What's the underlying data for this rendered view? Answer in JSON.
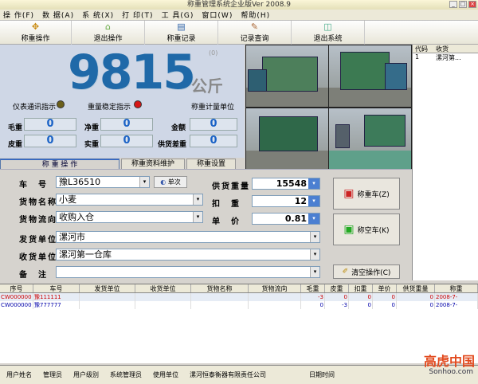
{
  "window": {
    "title": "称重管理系统企业版Ver 2008.9"
  },
  "menu": [
    "操 作(F)",
    "数 据(A)",
    "系 统(X)",
    "打 印(T)",
    "工 具(G)",
    "窗口(W)",
    "帮助(H)"
  ],
  "toolbar": [
    {
      "label": "称重操作",
      "icon": "✥"
    },
    {
      "label": "退出操作",
      "icon": "⌂"
    },
    {
      "label": "称重记录",
      "icon": "▤"
    },
    {
      "label": "记录查询",
      "icon": "✎"
    },
    {
      "label": "退出系统",
      "icon": "◫"
    }
  ],
  "display": {
    "weight": "9815",
    "unit": "公斤",
    "small_value": "(0)",
    "ind_comm": "仪表通讯指示",
    "ind_stable": "重量稳定指示",
    "ind_unit": "称重计量单位",
    "comm_color": "#6b5f1a",
    "stable_color": "#d61616"
  },
  "summary": {
    "gross_label": "毛重",
    "gross": "0",
    "net_label": "净重",
    "net": "0",
    "amount_label": "金额",
    "amount": "0",
    "tare_label": "皮重",
    "tare": "0",
    "actual_label": "实重",
    "actual": "0",
    "diff_label": "供货差重",
    "diff": "0"
  },
  "tabs": [
    "称 重 操 作",
    "称重资料维护",
    "称重设置"
  ],
  "form": {
    "plate_label": "车　号",
    "plate": "豫L36510",
    "single_label": "单次",
    "goods_label": "货物名称",
    "goods": "小麦",
    "flow_label": "货物流向",
    "flow": "收购入仓",
    "sender_label": "发货单位",
    "sender": "漯河市",
    "receiver_label": "收货单位",
    "receiver": "漯河第一仓库",
    "note_label": "备　注",
    "note": "",
    "supply_label": "供货重量",
    "supply": "15548",
    "deduct_label": "扣　重",
    "deduct": "12",
    "price_label": "单　价",
    "price": "0.81"
  },
  "actions": {
    "heavy": "称重车(Z)",
    "empty": "称空车(K)",
    "clear": "清空操作(C)"
  },
  "right_panel": {
    "headers": [
      "代码",
      "收货"
    ],
    "rows": [
      [
        "1",
        "漯河第..."
      ]
    ]
  },
  "grid": {
    "headers": [
      "序号",
      "车号",
      "发货单位",
      "收货单位",
      "货物名称",
      "货物流向",
      "毛重",
      "皮重",
      "扣重",
      "单价",
      "供货重量",
      "称重"
    ],
    "rows": [
      [
        "CW000000",
        "豫111111",
        "",
        "",
        "",
        "",
        "-3",
        "0",
        "0",
        "0",
        "0",
        "2008-7-"
      ],
      [
        "CW000000",
        "豫777777",
        "",
        "",
        "",
        "",
        "0",
        "-3",
        "0",
        "0",
        "0",
        "2008-7-"
      ]
    ]
  },
  "status": [
    "用户姓名",
    "管理员",
    "用户级别",
    "系统管理员",
    "使用单位",
    "漯河恒泰衡器有限责任公司",
    "日期时间"
  ],
  "watermark": {
    "brand": "高虎中国",
    "site": "Sonhoo.com"
  }
}
